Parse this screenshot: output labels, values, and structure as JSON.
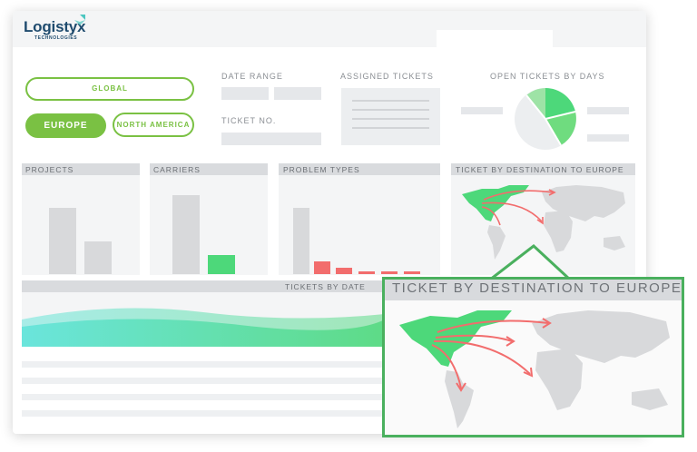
{
  "brand": {
    "name": "Logistyx",
    "tagline": "TECHNOLOGIES"
  },
  "filters": {
    "global_label": "GLOBAL",
    "europe_label": "EUROPE",
    "north_america_label": "NORTH AMERICA",
    "selected": "EUROPE"
  },
  "fields": {
    "date_range_label": "DATE RANGE",
    "ticket_no_label": "TICKET NO.",
    "assigned_tickets_label": "ASSIGNED TICKETS",
    "open_tickets_label": "OPEN TICKETS BY DAYS"
  },
  "panels": {
    "projects": "PROJECTS",
    "carriers": "CARRIERS",
    "problem_types": "PROBLEM TYPES",
    "destination": "TICKET BY DESTINATION TO EUROPE",
    "tickets_by_date": "TICKETS BY DATE"
  },
  "zoom": {
    "title": "TICKET BY DESTINATION TO EUROPE"
  },
  "colors": {
    "accent_green": "#7ac143",
    "map_green": "#4dd87a",
    "arrow_red": "#f26d6d",
    "zoom_border": "#4ab05e"
  }
}
